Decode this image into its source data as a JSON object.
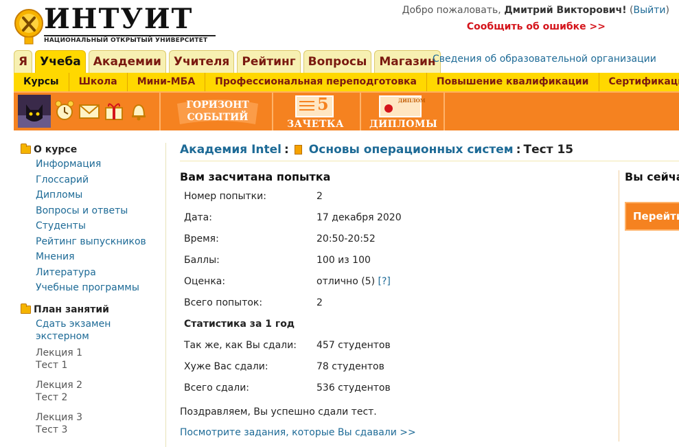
{
  "header": {
    "logo_text": "ИНТУИТ",
    "logo_tagline": "НАЦИОНАЛЬНЫЙ ОТКРЫТЫЙ УНИВЕРСИТЕТ",
    "welcome_prefix": "Добро пожаловать,",
    "user_name": "Дмитрий Викторович",
    "exclaim": "!",
    "logout_open": "(",
    "logout_label": "Выйти",
    "logout_close": ")",
    "report_error": "Сообщить об ошибке >>"
  },
  "tabs": [
    {
      "label": "Я",
      "active": false
    },
    {
      "label": "Учеба",
      "active": true
    },
    {
      "label": "Академии",
      "active": false
    },
    {
      "label": "Учителя",
      "active": false
    },
    {
      "label": "Рейтинг",
      "active": false
    },
    {
      "label": "Вопросы",
      "active": false
    },
    {
      "label": "Магазин",
      "active": false
    }
  ],
  "org_info_link": "Сведения об образовательной организации",
  "subnav": [
    "Курсы",
    "Школа",
    "Мини-МБА",
    "Профессиональная переподготовка",
    "Повышение квалификации",
    "Сертификации"
  ],
  "toolbar": {
    "horizon_line1": "ГОРИЗОНТ",
    "horizon_line2": "СОБЫТИЙ",
    "gradebook_number": "5",
    "gradebook_label": "ЗАЧЕТКА",
    "diploma_badge": "ДИПЛОМ",
    "diplomas_label": "ДИПЛОМЫ",
    "icons": [
      "avatar-cat",
      "alarm-clock-icon",
      "envelope-icon",
      "gift-icon",
      "bell-icon"
    ]
  },
  "sidebar": {
    "about_title": "О курсе",
    "about_items": [
      "Информация",
      "Глоссарий",
      "Дипломы",
      "Вопросы и ответы",
      "Студенты",
      "Рейтинг выпускников",
      "Мнения",
      "Литература",
      "Учебные программы"
    ],
    "plan_title": "План занятий",
    "plan_items": [
      "Сдать экзамен",
      "экстерном"
    ],
    "lessons": [
      {
        "lecture": "Лекция 1",
        "test": "Тест 1"
      },
      {
        "lecture": "Лекция 2",
        "test": "Тест 2"
      },
      {
        "lecture": "Лекция 3",
        "test": "Тест 3"
      }
    ]
  },
  "breadcrumb": {
    "academy": "Академия Intel",
    "sep1": ":",
    "course": "Основы операционных систем",
    "sep2": ":",
    "current": "Тест 15"
  },
  "result": {
    "title": "Вам засчитана попытка",
    "rows": [
      {
        "label": "Номер попытки:",
        "value": "2"
      },
      {
        "label": "Дата:",
        "value": "17 декабря 2020"
      },
      {
        "label": "Время:",
        "value": "20:50-20:52"
      },
      {
        "label": "Баллы:",
        "value": "100 из 100"
      },
      {
        "label": "Оценка:",
        "value": "отлично (5)",
        "help": "[?]"
      },
      {
        "label": "Всего попыток:",
        "value": "2"
      }
    ],
    "stats_title": "Статистика за 1 год",
    "stats_rows": [
      {
        "label": "Так же, как Вы сдали:",
        "value": "457 студентов"
      },
      {
        "label": "Хуже Вас сдали:",
        "value": "78 студентов"
      },
      {
        "label": "Всего сдали:",
        "value": "536 студентов"
      }
    ],
    "congrats": "Поздравляем, Вы успешно сдали тест.",
    "tasks_link": "Посмотрите задания, которые Вы сдавали >>"
  },
  "right_panel": {
    "heading": "Вы сейча",
    "button": "Перейти"
  },
  "colors": {
    "orange": "#f58220",
    "yellow": "#ffd800",
    "link": "#1d6a96",
    "error_red": "#d4141b"
  }
}
